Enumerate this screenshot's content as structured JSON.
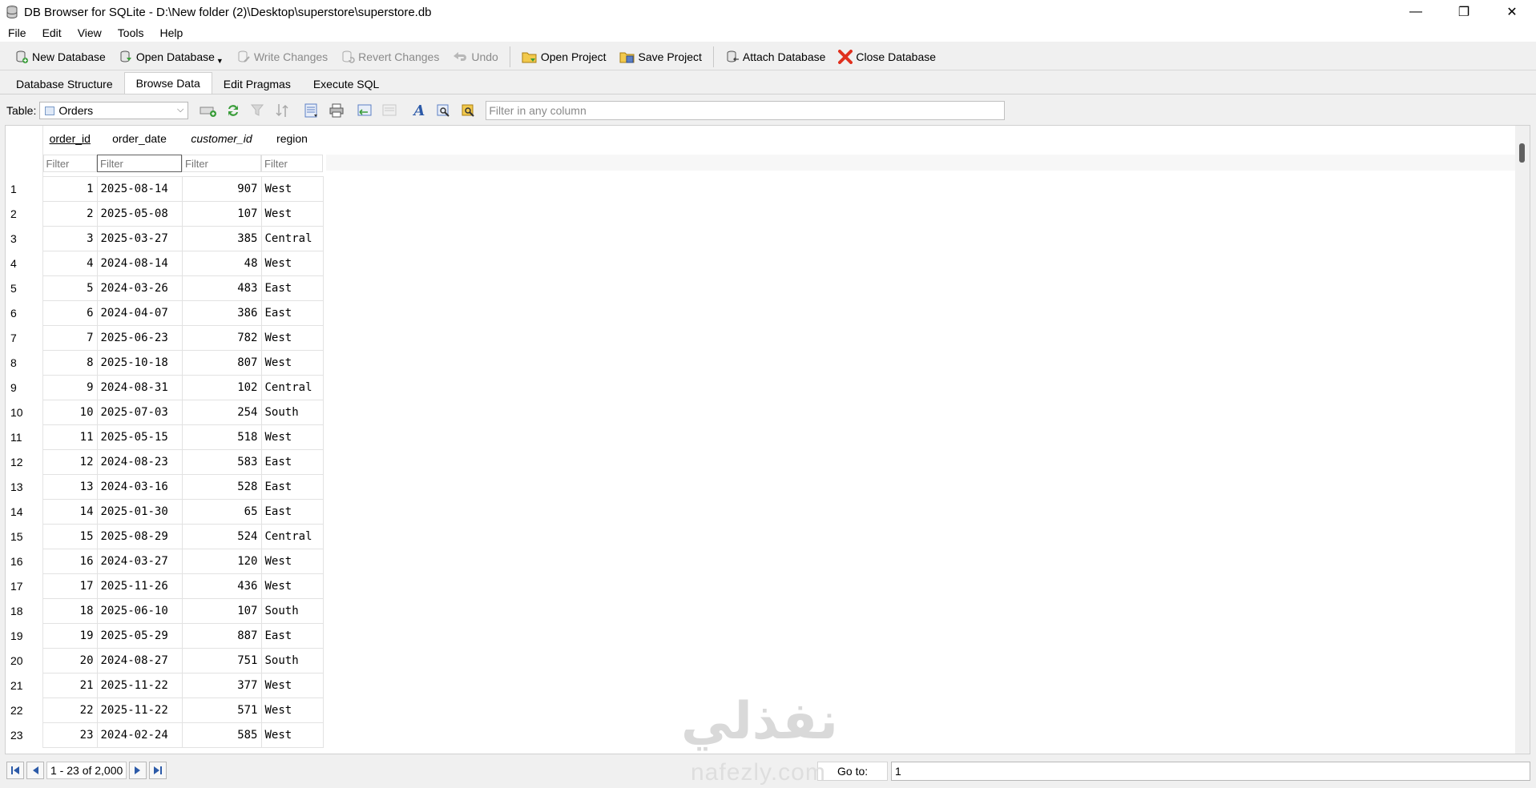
{
  "window": {
    "title": "DB Browser for SQLite - D:\\New folder (2)\\Desktop\\superstore\\superstore.db",
    "controls": [
      "—",
      "❐",
      "✕"
    ]
  },
  "menu": [
    "File",
    "Edit",
    "View",
    "Tools",
    "Help"
  ],
  "toolbar": {
    "new_database": "New Database",
    "open_database": "Open Database",
    "write_changes": "Write Changes",
    "revert_changes": "Revert Changes",
    "undo": "Undo",
    "open_project": "Open Project",
    "save_project": "Save Project",
    "attach_database": "Attach Database",
    "close_database": "Close Database"
  },
  "tabs": [
    "Database Structure",
    "Browse Data",
    "Edit Pragmas",
    "Execute SQL"
  ],
  "browse": {
    "table_label": "Table:",
    "table_value": "Orders",
    "filter_placeholder": "Filter in any column"
  },
  "grid": {
    "columns": [
      "order_id",
      "order_date",
      "customer_id",
      "region"
    ],
    "filter_placeholder": "Filter",
    "rows": [
      [
        "1",
        "2025-08-14",
        "907",
        "West"
      ],
      [
        "2",
        "2025-05-08",
        "107",
        "West"
      ],
      [
        "3",
        "2025-03-27",
        "385",
        "Central"
      ],
      [
        "4",
        "2024-08-14",
        "48",
        "West"
      ],
      [
        "5",
        "2024-03-26",
        "483",
        "East"
      ],
      [
        "6",
        "2024-04-07",
        "386",
        "East"
      ],
      [
        "7",
        "2025-06-23",
        "782",
        "West"
      ],
      [
        "8",
        "2025-10-18",
        "807",
        "West"
      ],
      [
        "9",
        "2024-08-31",
        "102",
        "Central"
      ],
      [
        "10",
        "2025-07-03",
        "254",
        "South"
      ],
      [
        "11",
        "2025-05-15",
        "518",
        "West"
      ],
      [
        "12",
        "2024-08-23",
        "583",
        "East"
      ],
      [
        "13",
        "2024-03-16",
        "528",
        "East"
      ],
      [
        "14",
        "2025-01-30",
        "65",
        "East"
      ],
      [
        "15",
        "2025-08-29",
        "524",
        "Central"
      ],
      [
        "16",
        "2024-03-27",
        "120",
        "West"
      ],
      [
        "17",
        "2025-11-26",
        "436",
        "West"
      ],
      [
        "18",
        "2025-06-10",
        "107",
        "South"
      ],
      [
        "19",
        "2025-05-29",
        "887",
        "East"
      ],
      [
        "20",
        "2024-08-27",
        "751",
        "South"
      ],
      [
        "21",
        "2025-11-22",
        "377",
        "West"
      ],
      [
        "22",
        "2025-11-22",
        "571",
        "West"
      ],
      [
        "23",
        "2024-02-24",
        "585",
        "West"
      ]
    ]
  },
  "status": {
    "range": "1 - 23 of 2,000",
    "goto_label": "Go to:",
    "goto_value": "1"
  },
  "watermark": {
    "arabic": "نفذلي",
    "latin": "nafezly.com"
  }
}
